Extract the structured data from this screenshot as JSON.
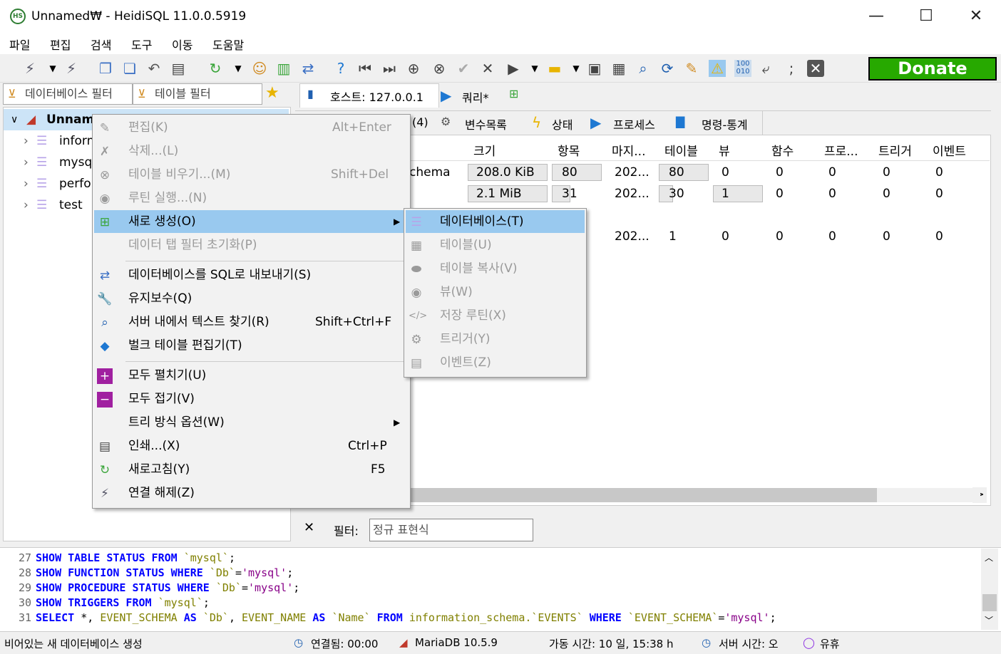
{
  "window": {
    "title": "Unnamed₩ - HeidiSQL 11.0.0.5919",
    "icon_text": "HS",
    "minimize": "—",
    "maximize": "☐",
    "close": "✕"
  },
  "menubar": [
    "파일",
    "편집",
    "검색",
    "도구",
    "이동",
    "도움말"
  ],
  "toolbar": {
    "donate_label": "Donate"
  },
  "filters": {
    "db_filter": "데이터베이스 필터",
    "table_filter": "테이블 필터"
  },
  "tree": {
    "root": "Unnamed",
    "items": [
      "information_schema",
      "mysql",
      "performance_schema",
      "test"
    ]
  },
  "righttabs": {
    "host": "호스트: 127.0.0.1",
    "query": "쿼리*"
  },
  "subtabs": {
    "databases": "(4)",
    "variables": "변수목록",
    "status": "상태",
    "processes": "프로세스",
    "commands": "명령-통계"
  },
  "grid": {
    "columns": [
      "크기",
      "항목",
      "마지...",
      "테이블",
      "뷰",
      "함수",
      "프로...",
      "트리거",
      "이벤트"
    ],
    "rows": [
      [
        "chema",
        "208.0 KiB",
        "80",
        "202...",
        "80",
        "0",
        "0",
        "0",
        "0",
        "0"
      ],
      [
        "",
        "2.1 MiB",
        "31",
        "202...",
        "30",
        "1",
        "0",
        "0",
        "0",
        "0"
      ],
      [
        "",
        "",
        "",
        "",
        "",
        "",
        "",
        "",
        "",
        ""
      ],
      [
        "",
        "",
        "",
        "202...",
        "1",
        "0",
        "0",
        "0",
        "0",
        "0"
      ]
    ],
    "scroll_arrow": ">"
  },
  "filter_bar": {
    "close": "✕",
    "label": "필터:",
    "placeholder": "정규 표현식"
  },
  "context_menu": {
    "items": [
      {
        "label": "편집(K)",
        "shortcut": "Alt+Enter",
        "disabled": true
      },
      {
        "label": "삭제...(L)",
        "shortcut": "",
        "disabled": true
      },
      {
        "label": "테이블 비우기...(M)",
        "shortcut": "Shift+Del",
        "disabled": true
      },
      {
        "label": "루틴 실행...(N)",
        "shortcut": "",
        "disabled": true
      },
      {
        "label": "새로 생성(O)",
        "shortcut": "",
        "disabled": false,
        "submenu": true
      },
      {
        "label": "데이터 탭 필터 초기화(P)",
        "shortcut": "",
        "disabled": true
      },
      {
        "label": "데이터베이스를 SQL로 내보내기(S)",
        "shortcut": "",
        "disabled": false
      },
      {
        "label": "유지보수(Q)",
        "shortcut": "",
        "disabled": false
      },
      {
        "label": "서버 내에서 텍스트 찾기(R)",
        "shortcut": "Shift+Ctrl+F",
        "disabled": false
      },
      {
        "label": "벌크 테이블 편집기(T)",
        "shortcut": "",
        "disabled": false
      },
      {
        "label": "모두 펼치기(U)",
        "shortcut": "",
        "disabled": false
      },
      {
        "label": "모두 접기(V)",
        "shortcut": "",
        "disabled": false
      },
      {
        "label": "트리 방식 옵션(W)",
        "shortcut": "",
        "disabled": false,
        "submenu": true
      },
      {
        "label": "인쇄...(X)",
        "shortcut": "Ctrl+P",
        "disabled": false
      },
      {
        "label": "새로고침(Y)",
        "shortcut": "F5",
        "disabled": false
      },
      {
        "label": "연결 해제(Z)",
        "shortcut": "",
        "disabled": false
      }
    ]
  },
  "submenu": {
    "items": [
      {
        "label": "데이터베이스(T)",
        "disabled": false
      },
      {
        "label": "테이블(U)",
        "disabled": true
      },
      {
        "label": "테이블 복사(V)",
        "disabled": true
      },
      {
        "label": "뷰(W)",
        "disabled": true
      },
      {
        "label": "저장 루틴(X)",
        "disabled": true
      },
      {
        "label": "트리거(Y)",
        "disabled": true
      },
      {
        "label": "이벤트(Z)",
        "disabled": true
      }
    ]
  },
  "sql_log": [
    {
      "n": "27"
    },
    {
      "n": "28"
    },
    {
      "n": "29"
    },
    {
      "n": "30"
    },
    {
      "n": "31"
    }
  ],
  "statusbar": {
    "left": "비어있는 새 데이터베이스 생성",
    "connected": "연결됨: 00:00",
    "server": "MariaDB 10.5.9",
    "uptime": "가동 시간: 10 일, 15:38 h",
    "server_time": "서버 시간: 오",
    "idle": "유휴"
  },
  "colors": {
    "menu_highlight": "#99c9ef",
    "donate": "#27a900",
    "sql_keyword": "#0000ff",
    "sql_string": "#808000"
  }
}
